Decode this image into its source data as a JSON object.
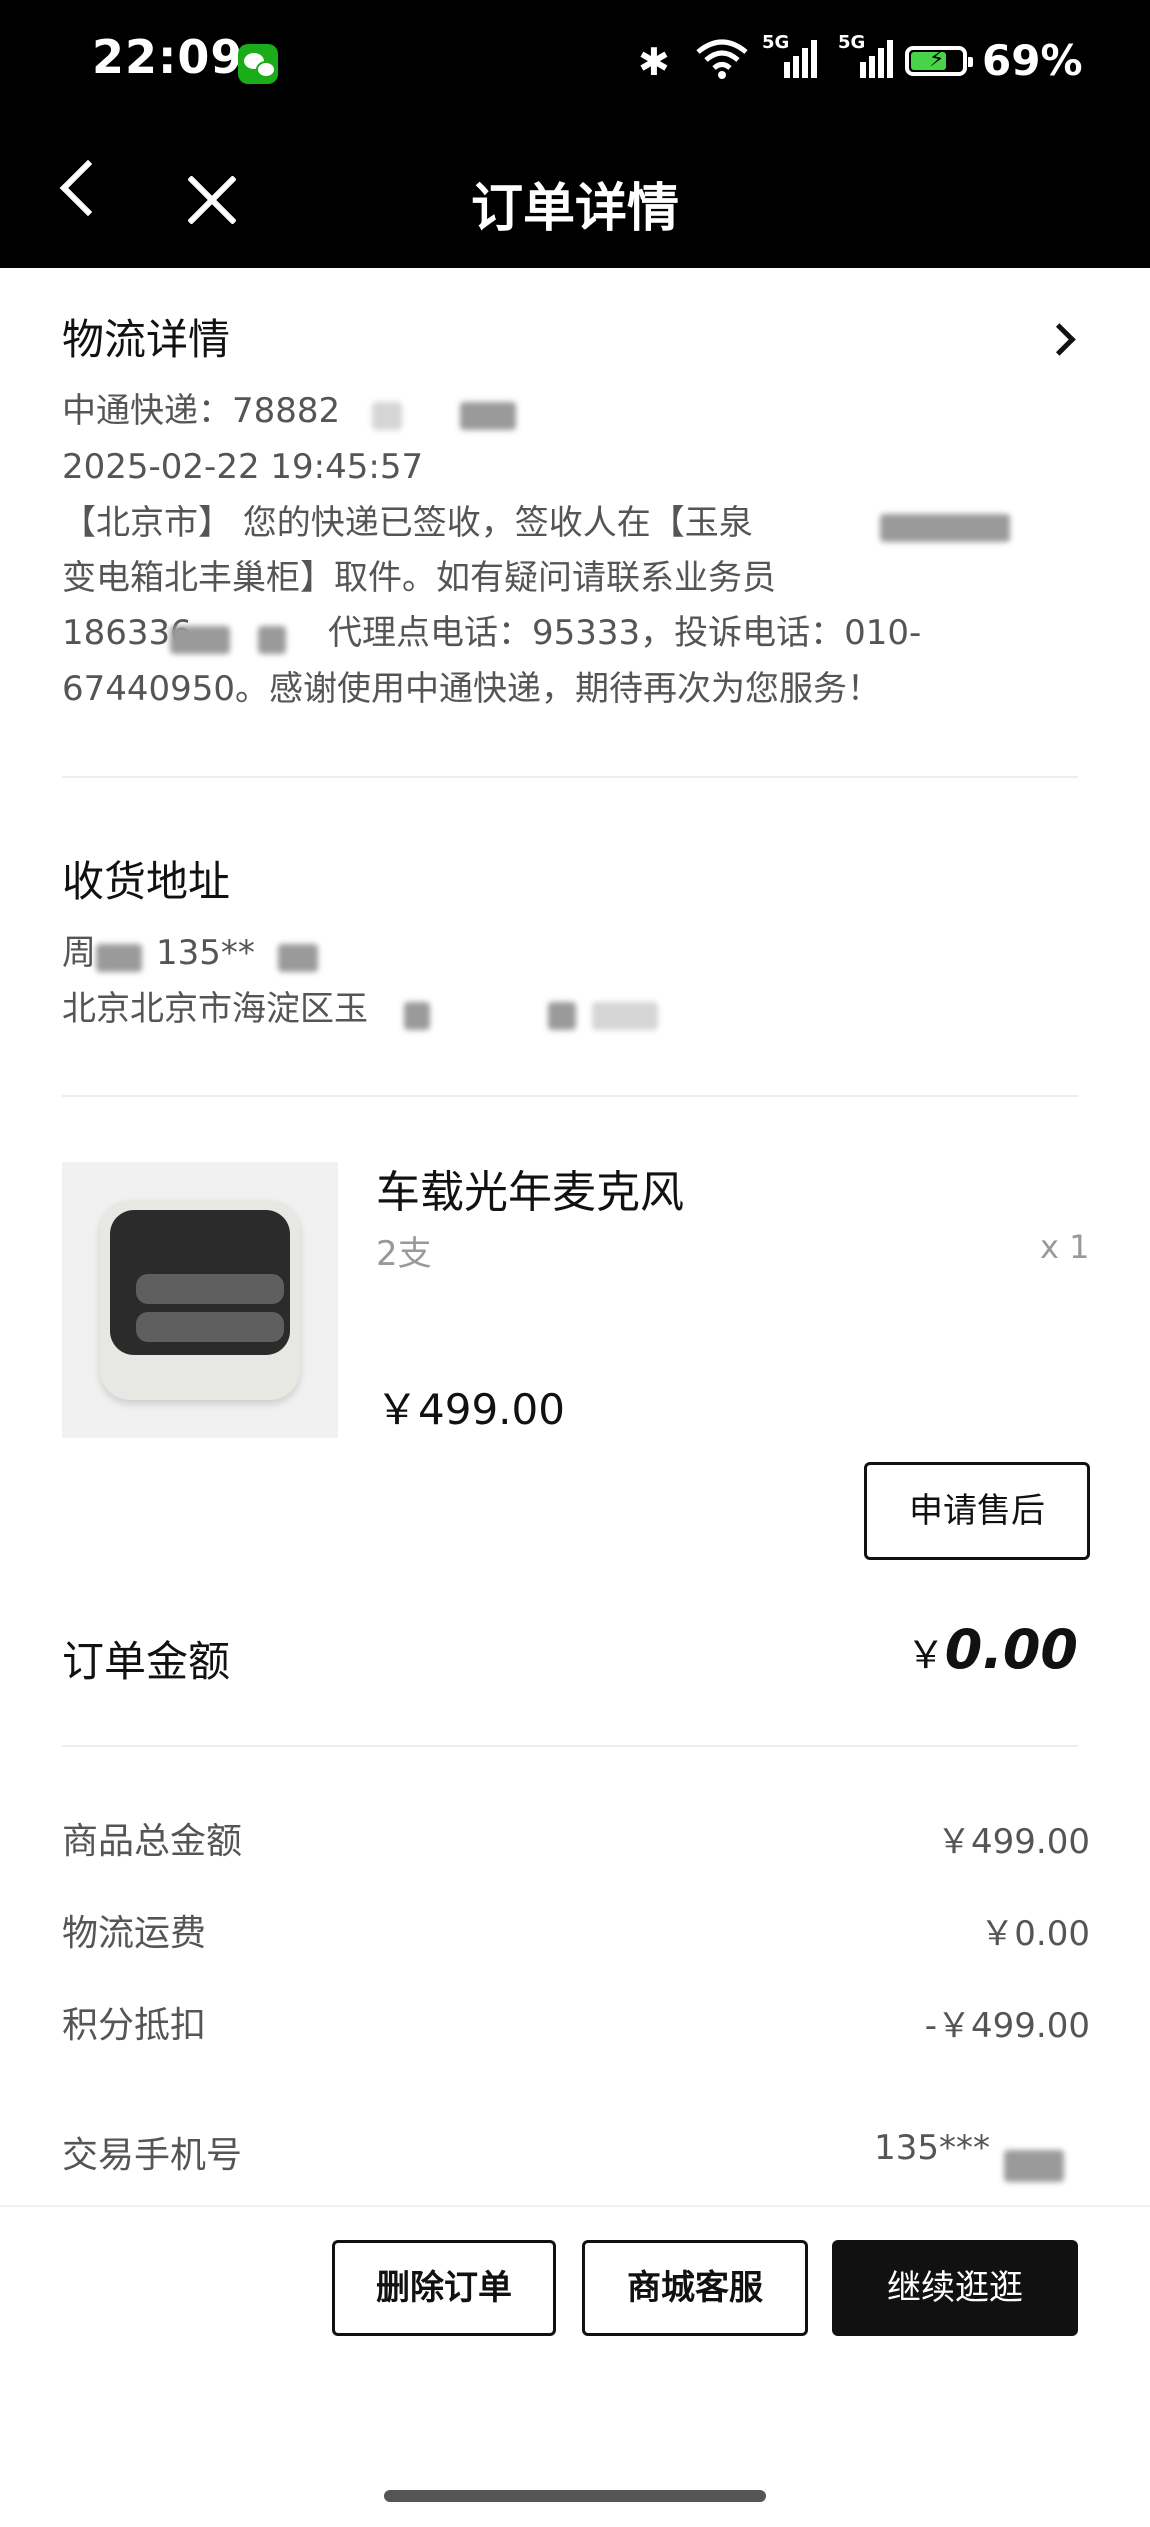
{
  "status_bar": {
    "time": "22:09",
    "battery": "69%",
    "network_a": "5G",
    "network_b": "5G",
    "battery_level": 0.69
  },
  "nav": {
    "title": "订单详情"
  },
  "logistics": {
    "heading": "物流详情",
    "tracking": "中通快递：78882",
    "datetime": "2025-02-22 19:45:57",
    "line1": "【北京市】 您的快递已签收，签收人在【玉泉",
    "line2": "变电箱北丰巢柜】取件。如有疑问请联系业务员",
    "line3a": "186336",
    "line3b": "代理点电话：95333，投诉电话：010-",
    "line4": "67440950。感谢使用中通快递，期待再次为您服务！"
  },
  "address": {
    "heading": "收货地址",
    "name_phone": "周",
    "phone": "135**",
    "detail": "北京北京市海淀区玉"
  },
  "product": {
    "name": "车载光年麦克风",
    "spec": "2支",
    "qty": "x 1",
    "price": "￥499.00",
    "after_sale_button": "申请售后"
  },
  "order_amount": {
    "label": "订单金额",
    "currency": "￥",
    "value": "0.00"
  },
  "summary": [
    {
      "label": "商品总金额",
      "value": "￥499.00"
    },
    {
      "label": "物流运费",
      "value": "￥0.00"
    },
    {
      "label": "积分抵扣",
      "value": "-￥499.00"
    }
  ],
  "phone_row": {
    "label": "交易手机号",
    "value": "135***"
  },
  "actions": {
    "delete": "删除订单",
    "service": "商城客服",
    "continue": "继续逛逛"
  },
  "colors": {
    "bar": "#000000",
    "primary_button": "#111111",
    "battery": "#47d447"
  }
}
